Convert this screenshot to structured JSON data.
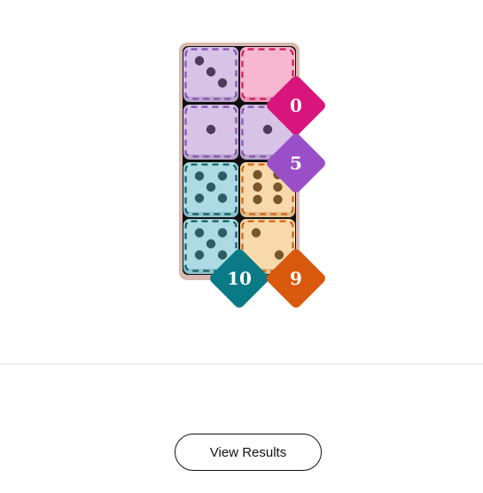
{
  "colors": {
    "tray": "#d9bab0",
    "purple": {
      "fill": "#d6c3e6",
      "shade": "#b9a6cb",
      "dash": "#8a4fb5",
      "pip": "#4d3a5c"
    },
    "pink": {
      "fill": "#f6b7cf",
      "shade": "#e79bb8",
      "dash": "#d8175f"
    },
    "teal": {
      "fill": "#aedbe3",
      "shade": "#8fc3cd",
      "dash": "#0e5f66",
      "pip": "#2e5b66"
    },
    "orange": {
      "fill": "#f7d9ac",
      "shade": "#e2bf8d",
      "dash": "#d4610f",
      "pip": "#7a5528"
    }
  },
  "dice": [
    {
      "row": 0,
      "col": 0,
      "value": 3,
      "color": "purple",
      "name": "die-r1-c1"
    },
    {
      "row": 0,
      "col": 1,
      "value": 0,
      "color": "pink",
      "name": "die-r1-c2"
    },
    {
      "row": 1,
      "col": 0,
      "value": 1,
      "color": "purple",
      "name": "die-r2-c1"
    },
    {
      "row": 1,
      "col": 1,
      "value": 1,
      "color": "purple",
      "name": "die-r2-c2"
    },
    {
      "row": 2,
      "col": 0,
      "value": 5,
      "color": "teal",
      "name": "die-r3-c1"
    },
    {
      "row": 2,
      "col": 1,
      "value": 6,
      "color": "orange",
      "name": "die-r3-c2"
    },
    {
      "row": 3,
      "col": 0,
      "value": 5,
      "color": "teal",
      "name": "die-r4-c1"
    },
    {
      "row": 3,
      "col": 1,
      "value": 2,
      "color": "orange",
      "name": "die-r4-c2"
    }
  ],
  "badges": [
    {
      "label": "0",
      "color": "#d8157c",
      "name": "score-badge-pink"
    },
    {
      "label": "5",
      "color": "#9a4fc9",
      "name": "score-badge-purple"
    },
    {
      "label": "10",
      "color": "#0a7a86",
      "name": "score-badge-teal"
    },
    {
      "label": "9",
      "color": "#d8590d",
      "name": "score-badge-orange"
    }
  ],
  "button": {
    "label": "View Results"
  }
}
